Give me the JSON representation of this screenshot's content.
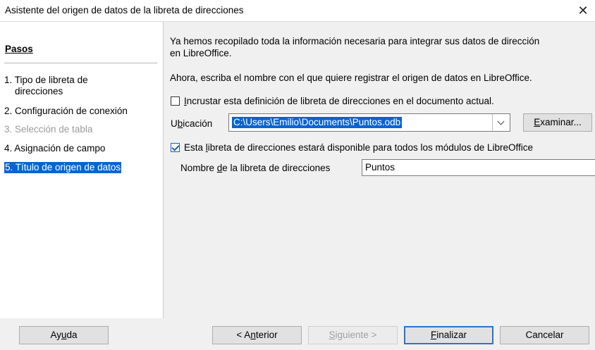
{
  "window": {
    "title": "Asistente del origen de datos de la libreta de direcciones",
    "close_glyph": "✕"
  },
  "sidebar": {
    "heading": "Pasos",
    "items": [
      {
        "label": "1. Tipo de libreta de",
        "label2": "direcciones",
        "state": "normal"
      },
      {
        "label": "2. Configuración de conexión",
        "state": "normal"
      },
      {
        "label": "3. Selección de tabla",
        "state": "disabled"
      },
      {
        "label": "4. Asignación de campo",
        "state": "normal"
      },
      {
        "label": "5. Título de origen de datos",
        "state": "selected"
      }
    ]
  },
  "main": {
    "intro_line1": "Ya hemos recopilado toda la información necesaria para integrar sus datos de dirección",
    "intro_line2": "en LibreOffice.",
    "instruction": "Ahora, escriba el nombre con el que quiere registrar el origen de datos en LibreOffice.",
    "embed_checkbox": {
      "checked": false,
      "label_pre": "",
      "label_u": "I",
      "label_post": "ncrustar esta definición de libreta de direcciones en el documento actual."
    },
    "location": {
      "label_pre": "U",
      "label_u": "b",
      "label_post": "icación",
      "value": "C:\\Users\\Emilio\\Documents\\Puntos.odb"
    },
    "browse_button": {
      "u": "E",
      "rest": "xaminar..."
    },
    "available_checkbox": {
      "checked": true,
      "label_pre": "Esta ",
      "label_u": "l",
      "label_post": "ibreta de direcciones estará disponible para todos los módulos de LibreOffice"
    },
    "name_field": {
      "label_pre": "Nombre ",
      "label_u": "d",
      "label_post": "e la libreta de direcciones",
      "value": "Puntos"
    }
  },
  "footer": {
    "help": {
      "pre": "Ay",
      "u": "u",
      "post": "da"
    },
    "back": {
      "pre": "< A",
      "u": "n",
      "post": "terior"
    },
    "next": {
      "pre": "",
      "u": "S",
      "post": "iguiente >"
    },
    "finish": {
      "pre": "",
      "u": "F",
      "post": "inalizar"
    },
    "cancel": {
      "label": "Cancelar"
    }
  },
  "colors": {
    "accent": "#0a64d0",
    "disabled_text": "#9a9a9a"
  }
}
